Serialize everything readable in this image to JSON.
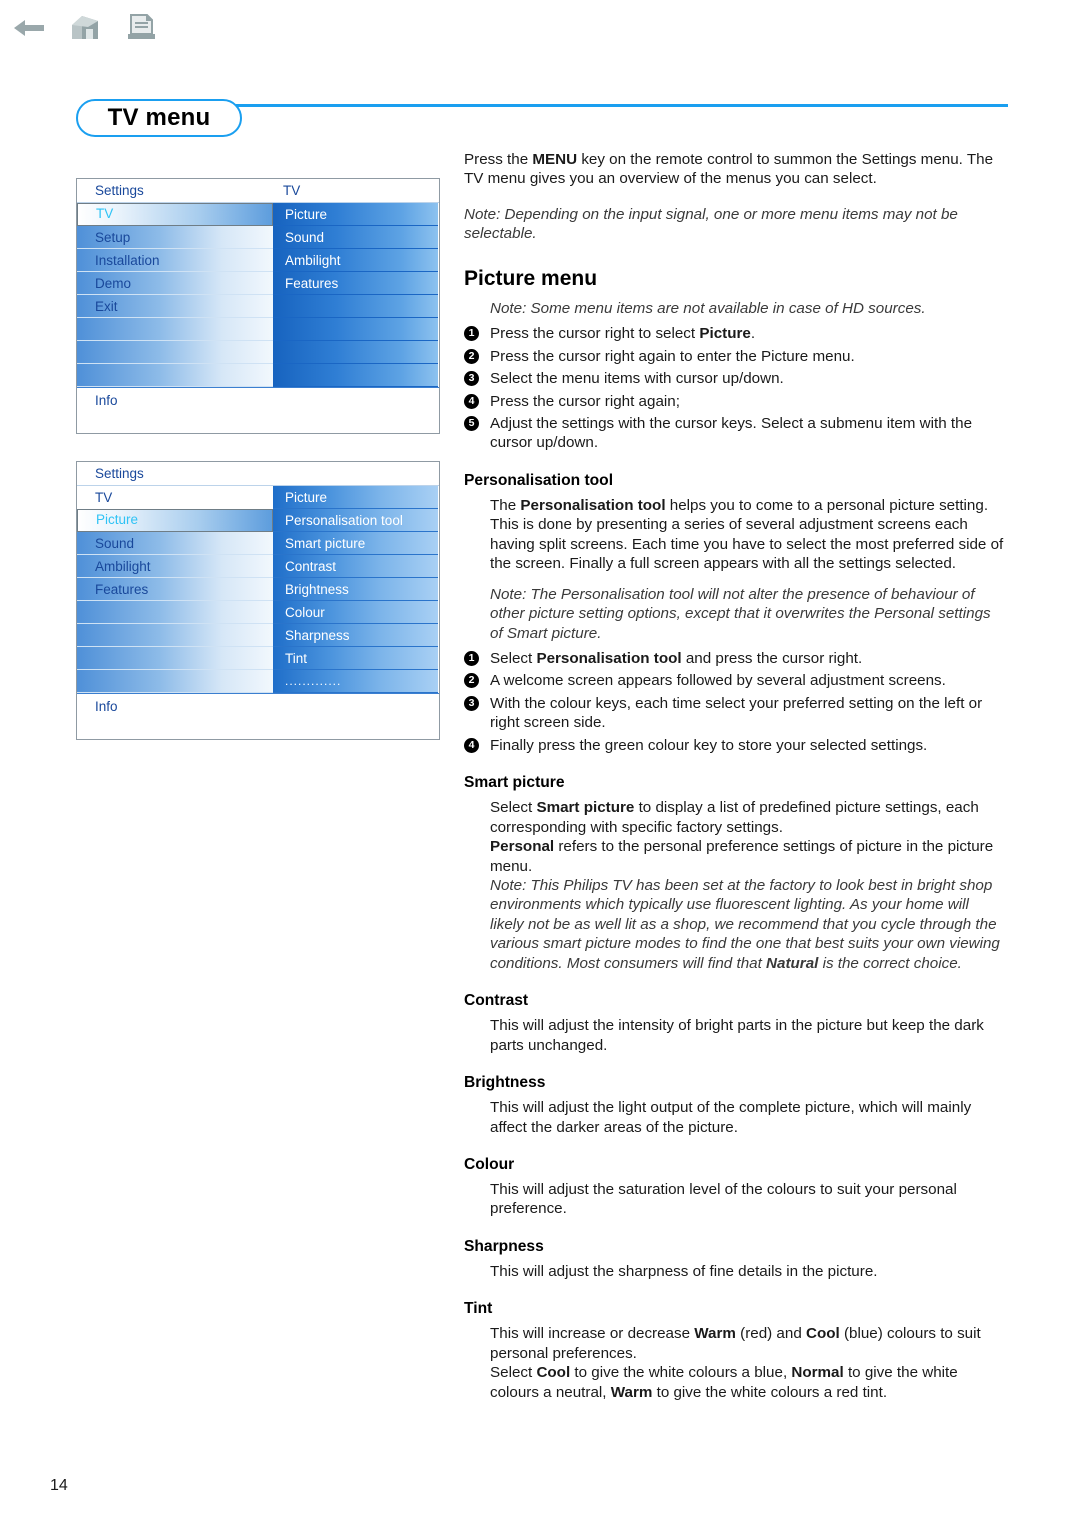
{
  "toolbar": {
    "icons": [
      {
        "name": "back-arrow-icon",
        "label": "Back"
      },
      {
        "name": "home-icon",
        "label": "Home"
      },
      {
        "name": "print-document-icon",
        "label": "Print"
      }
    ]
  },
  "header": {
    "title": "TV menu",
    "accent_color": "#1a9ff0"
  },
  "osd_menus": [
    {
      "id": "menu-tv",
      "head_left": "Settings",
      "head_right": "TV",
      "left_items": [
        {
          "label": "TV",
          "selected": true
        },
        {
          "label": "Setup",
          "selected": false
        },
        {
          "label": "Installation",
          "selected": false
        },
        {
          "label": "Demo",
          "selected": false
        },
        {
          "label": "Exit",
          "selected": false
        },
        {
          "label": "",
          "selected": false
        },
        {
          "label": "",
          "selected": false
        },
        {
          "label": "",
          "selected": false
        }
      ],
      "right_items": [
        {
          "label": "Picture"
        },
        {
          "label": "Sound"
        },
        {
          "label": "Ambilight"
        },
        {
          "label": "Features"
        },
        {
          "label": ""
        },
        {
          "label": ""
        },
        {
          "label": ""
        },
        {
          "label": ""
        }
      ],
      "footer": "Info"
    },
    {
      "id": "menu-picture",
      "head_left": "Settings",
      "head_right": "",
      "sub_left": "TV",
      "sub_right": "Picture",
      "left_items": [
        {
          "label": "Picture",
          "selected": true
        },
        {
          "label": "Sound",
          "selected": false
        },
        {
          "label": "Ambilight",
          "selected": false
        },
        {
          "label": "Features",
          "selected": false
        },
        {
          "label": "",
          "selected": false
        },
        {
          "label": "",
          "selected": false
        },
        {
          "label": "",
          "selected": false
        },
        {
          "label": "",
          "selected": false
        }
      ],
      "right_items": [
        {
          "label": "Personalisation tool"
        },
        {
          "label": "Smart picture"
        },
        {
          "label": "Contrast"
        },
        {
          "label": "Brightness"
        },
        {
          "label": "Colour"
        },
        {
          "label": "Sharpness"
        },
        {
          "label": "Tint"
        },
        {
          "label": "............."
        }
      ],
      "footer": "Info"
    }
  ],
  "content": {
    "intro_line1_a": "Press the ",
    "intro_line1_b": "MENU",
    "intro_line1_c": " key on the remote control to summon the Settings menu.",
    "intro_line2": "The TV menu gives you an overview of the menus you can select.",
    "intro_note": "Note: Depending on the input signal, one or more menu items may not be selectable.",
    "picture_menu_heading": "Picture menu",
    "picture_menu_note": "Note: Some menu items are not available in case of HD sources.",
    "picture_steps": [
      {
        "num": "1",
        "pre": "Press the cursor right to select ",
        "bold": "Picture",
        "post": "."
      },
      {
        "num": "2",
        "pre": "Press the cursor right again to enter the Picture menu.",
        "bold": "",
        "post": ""
      },
      {
        "num": "3",
        "pre": "Select the menu items with cursor up/down.",
        "bold": "",
        "post": ""
      },
      {
        "num": "4",
        "pre": "Press the cursor right again;",
        "bold": "",
        "post": ""
      },
      {
        "num": "5",
        "pre": "Adjust the settings with the cursor keys. Select a submenu item with the cursor up/down.",
        "bold": "",
        "post": ""
      }
    ],
    "personalisation": {
      "heading": "Personalisation tool",
      "body_a": "The ",
      "body_b": "Personalisation tool",
      "body_c": " helps you to come to a personal picture setting. This is done by presenting a series of several adjustment screens each having split screens. Each time you have to select the most preferred side of the screen. Finally a full screen appears with all the settings selected.",
      "note": "Note: The Personalisation tool will not alter the presence of behaviour of other picture setting options, except that it overwrites the Personal settings of Smart picture.",
      "steps": [
        {
          "num": "1",
          "pre": "Select ",
          "bold": "Personalisation tool",
          "post": " and press the cursor right."
        },
        {
          "num": "2",
          "pre": "A welcome screen appears followed by several adjustment screens.",
          "bold": "",
          "post": ""
        },
        {
          "num": "3",
          "pre": "With the colour keys, each time select your preferred setting on the left or right screen side.",
          "bold": "",
          "post": ""
        },
        {
          "num": "4",
          "pre": "Finally press the green colour key to store your selected settings.",
          "bold": "",
          "post": ""
        }
      ]
    },
    "smart_picture": {
      "heading": "Smart picture",
      "p1_a": "Select ",
      "p1_b": "Smart picture",
      "p1_c": " to display a list of predefined picture settings, each corresponding with specific factory settings.",
      "p2_a": "Personal",
      "p2_b": " refers to the personal preference settings of picture in the picture menu.",
      "note_a": "Note: This Philips TV has been set at the factory to look best in bright shop environments which typically use fluorescent lighting. As your home will likely not be as well lit as a shop, we recommend that you cycle through the various smart picture modes to find the one that best suits your own viewing conditions. Most consumers will find that ",
      "note_b": "Natural",
      "note_c": " is the correct choice."
    },
    "contrast": {
      "heading": "Contrast",
      "body": "This will adjust the intensity of bright parts in the picture but keep the dark parts unchanged."
    },
    "brightness": {
      "heading": "Brightness",
      "body": "This will adjust the light output of the complete picture, which will mainly affect the darker areas of the picture."
    },
    "colour": {
      "heading": "Colour",
      "body": "This will adjust the saturation level of the colours to suit your personal preference."
    },
    "sharpness": {
      "heading": "Sharpness",
      "body": "This will adjust the sharpness of fine details in the picture."
    },
    "tint": {
      "heading": "Tint",
      "p1_a": "This will increase or decrease ",
      "p1_b": "Warm",
      "p1_c": " (red) and ",
      "p1_d": "Cool",
      "p1_e": " (blue) colours to suit personal preferences.",
      "p2_a": "Select ",
      "p2_b": "Cool",
      "p2_c": " to give the white colours a blue, ",
      "p2_d": "Normal",
      "p2_e": " to give the white colours a neutral, ",
      "p2_f": "Warm",
      "p2_g": " to give the white colours a red tint."
    }
  },
  "page_number": "14"
}
